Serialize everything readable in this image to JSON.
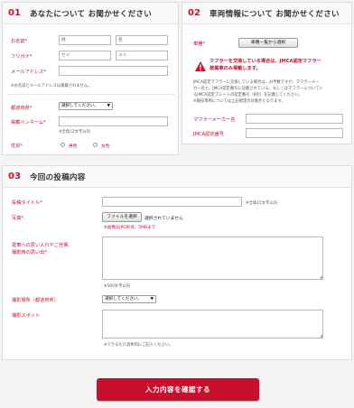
{
  "panel1": {
    "num": "01",
    "title": "あなたについて お聞かせください",
    "name_label": "お名前*",
    "name_last": "姓",
    "name_first": "名",
    "furigana_label": "フリガナ*",
    "furigana_last": "セイ",
    "furigana_first": "メイ",
    "email_label": "メールアドレス*",
    "email_note": "※お名前とメールアドレスは掲載されません。",
    "pref_label": "都道府県*",
    "pref_value": "選択してください。",
    "penname_label": "掲載ペンネーム*",
    "penname_note": "※全角12文字以内",
    "gender_label": "性別*",
    "gender_male": "男性",
    "gender_female": "女性"
  },
  "panel2": {
    "num": "02",
    "title": "車両情報について お聞かせください",
    "vehicle_label": "車種*",
    "vehicle_button": "車種一覧から選択",
    "warning_icon": "warning-icon",
    "warning_line1": "マフラーを交換している場合は、JMCA認定マフラー",
    "warning_line2": "装着車のみ掲載します。",
    "info_line1": "JMCA認定マフラーに交換している場合は、お手数ですが、マフラーメー",
    "info_line2": "カー名と、JMCA認定番号に記載されている、もしくはマフラーについてい",
    "info_line3": "るJMCA認定プレートの認定番号（8桁）を記載してください。",
    "info_line4": "※競技専用については上記規定の対象外となります。",
    "maker_label": "マフラーメーカー名",
    "jmca_label": "JMCA認定番号"
  },
  "panel3": {
    "num": "03",
    "title": "今回の投稿内容",
    "post_title_label": "投稿タイトル*",
    "post_title_note": "※全角15文字以内",
    "photo_label": "写真*",
    "file_button": "ファイルを選択",
    "file_status": "選択されていません",
    "photo_note": "※画像はJPG形式、5MBまで",
    "love_label_1": "愛車への思い入れやご自慢、",
    "love_label_2": "撮影時の思い出*",
    "love_note": "※500文字以内",
    "location_label": "撮影場所（都道府県）",
    "location_value": "選択してください。",
    "spot_label": "撮影スポット",
    "spot_note": "※できるだけ具体的にご記入ください。"
  },
  "submit_label": "入力内容を確認する",
  "colors": {
    "accent": "#c8102e"
  }
}
